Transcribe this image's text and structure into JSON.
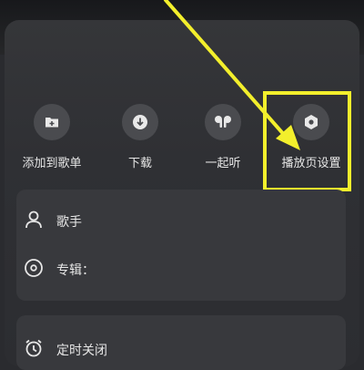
{
  "song": {
    "title": "",
    "artist": ""
  },
  "actions": [
    {
      "label": "添加到歌单",
      "icon": "add-to-playlist-icon"
    },
    {
      "label": "下载",
      "icon": "download-icon"
    },
    {
      "label": "一起听",
      "icon": "earbuds-icon"
    },
    {
      "label": "播放页设置",
      "icon": "hexagon-settings-icon"
    }
  ],
  "info": {
    "singer_label": "歌手",
    "singer_value": "",
    "album_label": "专辑：",
    "album_value": ""
  },
  "timer": {
    "label": "定时关闭"
  },
  "colors": {
    "annotation": "#f3ef2c",
    "sheet_bg": "#2f3034",
    "card_bg": "#38393d"
  }
}
